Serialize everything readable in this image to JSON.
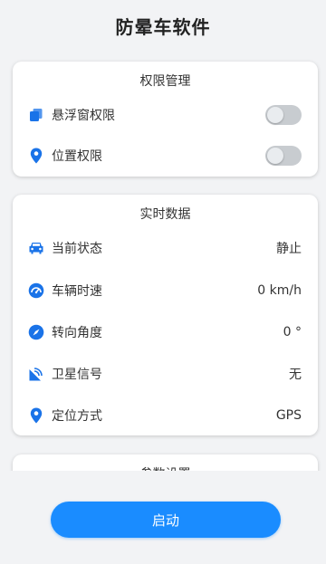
{
  "app": {
    "title": "防晕车软件"
  },
  "permissions": {
    "title": "权限管理",
    "items": [
      {
        "label": "悬浮窗权限",
        "icon": "overlay-windows-icon",
        "enabled": false
      },
      {
        "label": "位置权限",
        "icon": "location-pin-icon",
        "enabled": false
      }
    ]
  },
  "realtime": {
    "title": "实时数据",
    "items": [
      {
        "label": "当前状态",
        "value": "静止",
        "icon": "car-icon"
      },
      {
        "label": "车辆时速",
        "value": "0 km/h",
        "icon": "speedometer-icon"
      },
      {
        "label": "转向角度",
        "value": "0 °",
        "icon": "compass-icon"
      },
      {
        "label": "卫星信号",
        "value": "无",
        "icon": "satellite-icon"
      },
      {
        "label": "定位方式",
        "value": "GPS",
        "icon": "location-pin-icon"
      }
    ]
  },
  "params": {
    "title": "参数设置"
  },
  "actions": {
    "start_label": "启动"
  },
  "colors": {
    "accent": "#1a8cff",
    "icon": "#1a73e8"
  }
}
